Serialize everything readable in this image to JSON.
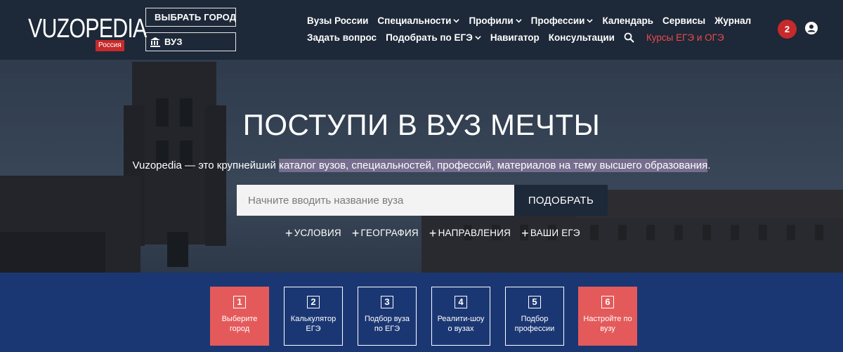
{
  "header": {
    "logo_text": "VUZOPEDIA",
    "logo_badge": "Россия",
    "city_button": "ВЫБРАТЬ ГОРОД",
    "vuz_button": "ВУЗ",
    "nav_row1": [
      {
        "label": "Вузы России",
        "dropdown": false
      },
      {
        "label": "Специальности",
        "dropdown": true
      },
      {
        "label": "Профили",
        "dropdown": true
      },
      {
        "label": "Профессии",
        "dropdown": true
      },
      {
        "label": "Календарь",
        "dropdown": false
      },
      {
        "label": "Сервисы",
        "dropdown": false
      },
      {
        "label": "Журнал",
        "dropdown": false
      }
    ],
    "nav_row2": [
      {
        "label": "Задать вопрос",
        "dropdown": false
      },
      {
        "label": "Подобрать по ЕГЭ",
        "dropdown": true
      },
      {
        "label": "Навигатор",
        "dropdown": false
      },
      {
        "label": "Консультации",
        "dropdown": false
      }
    ],
    "courses_link": "Курсы ЕГЭ и ОГЭ",
    "notification_count": "2"
  },
  "hero": {
    "title": "ПОСТУПИ В ВУЗ МЕЧТЫ",
    "subtitle_plain": "Vuzopedia — это крупнейший ",
    "subtitle_highlight": "каталог вузов, специальностей, профессий, материалов на тему высшего образования",
    "subtitle_end": ".",
    "search_placeholder": "Начните вводить название вуза",
    "search_button": "ПОДОБРАТЬ",
    "filters": [
      "УСЛОВИЯ",
      "ГЕОГРАФИЯ",
      "НАПРАВЛЕНИЯ",
      "ВАШИ ЕГЭ"
    ]
  },
  "steps": [
    {
      "num": "1",
      "label": "Выберите город",
      "highlight": true
    },
    {
      "num": "2",
      "label": "Калькулятор ЕГЭ",
      "highlight": false
    },
    {
      "num": "3",
      "label": "Подбор вуза по ЕГЭ",
      "highlight": false
    },
    {
      "num": "4",
      "label": "Реалити-шоу о вузах",
      "highlight": false
    },
    {
      "num": "5",
      "label": "Подбор профессии",
      "highlight": false
    },
    {
      "num": "6",
      "label": "Настройте по вузу",
      "highlight": true
    }
  ],
  "colors": {
    "header_bg": "#1d2838",
    "accent_red": "#c62a2a",
    "step_red": "#e45a5a",
    "steps_band": "#123784"
  },
  "icons": {
    "city": "location-target-icon",
    "vuz": "university-icon",
    "search": "search-icon",
    "user": "user-account-icon",
    "plus": "plus-icon",
    "dropdown": "chevron-down-icon"
  }
}
